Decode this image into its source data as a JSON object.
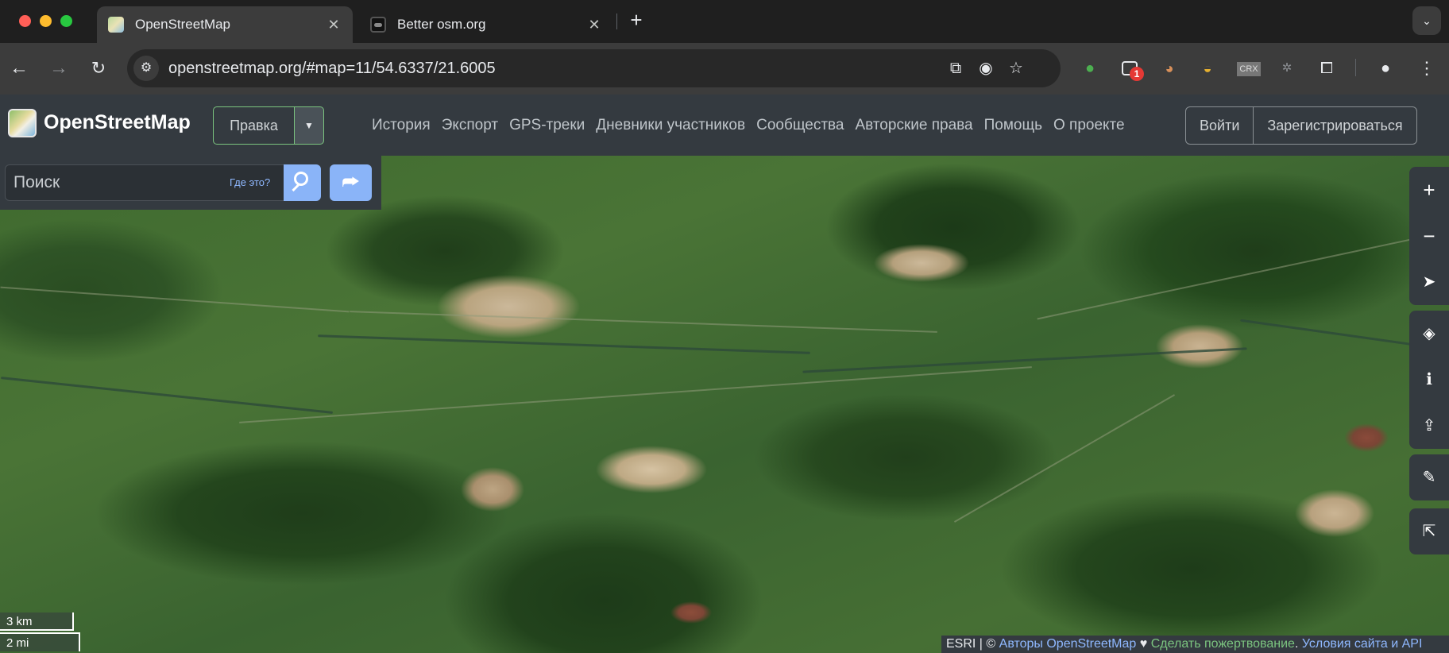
{
  "browser": {
    "tabs": [
      {
        "title": "OpenStreetMap",
        "close": "✕"
      },
      {
        "title": "Better osm.org",
        "close": "✕"
      }
    ],
    "new_tab": "+",
    "tab_menu": "⌄",
    "url": "openstreetmap.org/#map=11/54.6337/21.6005",
    "extensions": {
      "badge_count": "1",
      "crx_label": "CRX"
    }
  },
  "osm": {
    "logo_text": "OpenStreetMap",
    "edit_label": "Правка",
    "nav": [
      "История",
      "Экспорт",
      "GPS-треки",
      "Дневники участников",
      "Сообщества",
      "Авторские права",
      "Помощь",
      "О проекте"
    ],
    "login_label": "Войти",
    "signup_label": "Зарегистрироваться"
  },
  "search": {
    "placeholder": "Поиск",
    "where_label": "Где это?"
  },
  "scale": {
    "km": "3 km",
    "mi": "2 mi"
  },
  "attribution": {
    "provider": "ESRI | ©",
    "osm_authors": "Авторы OpenStreetMap",
    "heart": "♥",
    "donate": "Сделать пожертвование",
    "terms": "Условия сайта и API"
  },
  "colors": {
    "accent_blue": "#8ab4f8",
    "edit_green": "#7bc47f",
    "header_bg": "#343a40"
  }
}
